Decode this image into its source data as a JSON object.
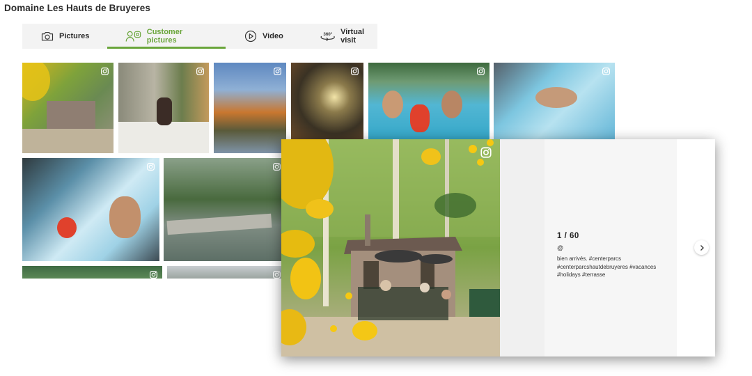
{
  "page": {
    "title": "Domaine Les Hauts de Bruyeres"
  },
  "tabs": [
    {
      "label": "Pictures",
      "icon": "camera-icon",
      "active": false
    },
    {
      "label": "Customer pictures",
      "icon": "user-instagram-icon",
      "active": true
    },
    {
      "label": "Video",
      "icon": "play-icon",
      "active": false
    },
    {
      "label": "Virtual visit",
      "icon": "360-icon",
      "active": false
    }
  ],
  "tab_icon_text": {
    "virtual": "360°"
  },
  "colors": {
    "accent": "#6aa53b",
    "tabbar_bg": "#f3f3f3"
  },
  "gallery": {
    "thumbnail_icon": "instagram-icon",
    "thumbnails": [
      {
        "subject": "cottage with yellow flowers"
      },
      {
        "subject": "woman in bed by window"
      },
      {
        "subject": "autumn lake"
      },
      {
        "subject": "child in forest at sunset"
      },
      {
        "subject": "family in pool"
      },
      {
        "subject": "woman swimming"
      },
      {
        "subject": "couple in pool with child"
      },
      {
        "subject": "pond with stepping stones"
      },
      {
        "subject": "forest"
      },
      {
        "subject": "trees"
      }
    ]
  },
  "lightbox": {
    "counter": "1 / 60",
    "handle": "@",
    "caption": "bien arrivés. #centerparcs #centerparcshautdebruyeres #vacances #holidays #terrasse",
    "next_icon": "chevron-right-icon",
    "photo_icon": "instagram-icon"
  }
}
